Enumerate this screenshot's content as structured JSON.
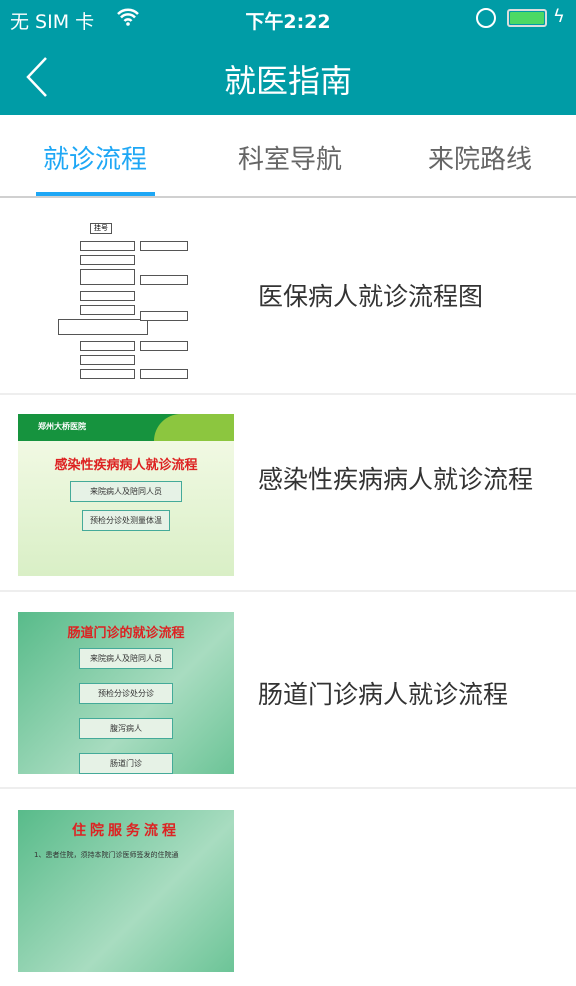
{
  "status_bar": {
    "carrier": "无 SIM 卡",
    "time": "下午2:22",
    "battery_percent": 100
  },
  "nav": {
    "title": "就医指南",
    "back_icon": "chevron-left-icon"
  },
  "tabs": [
    {
      "label": "就诊流程",
      "active": true
    },
    {
      "label": "科室导航"
    },
    {
      "label": "来院路线"
    }
  ],
  "list": [
    {
      "title": "医保病人就诊流程图",
      "thumb_lines": [
        "挂号"
      ]
    },
    {
      "title": "感染性疾病病人就诊流程",
      "thumb_hospital": "郑州大桥医院",
      "thumb_title": "感染性疾病病人就诊流程",
      "thumb_steps": [
        "来院病人及陪同人员",
        "预检分诊处测量体温"
      ]
    },
    {
      "title": "肠道门诊病人就诊流程",
      "thumb_title": "肠道门诊的就诊流程",
      "thumb_steps": [
        "来院病人及陪同人员",
        "预检分诊处分诊",
        "腹泻病人",
        "肠道门诊"
      ]
    },
    {
      "title": "",
      "thumb_title": "住院服务流程",
      "thumb_text": "1、患者住院，须持本院门诊医师签发的住院通"
    }
  ],
  "colors": {
    "primary": "#009ca6",
    "tab_active": "#1ea7f5"
  }
}
